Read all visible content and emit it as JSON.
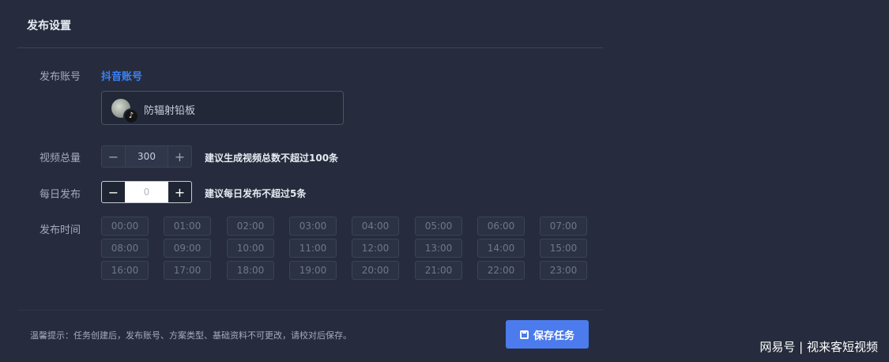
{
  "panel": {
    "title": "发布设置"
  },
  "account": {
    "label": "发布账号",
    "platform_link": "抖音账号",
    "selected_name": "防辐射铅板",
    "badge_icon": "tiktok-icon"
  },
  "total_videos": {
    "label": "视频总量",
    "value": "300",
    "hint": "建议生成视频总数不超过100条",
    "minus": "−",
    "plus": "+"
  },
  "daily_publish": {
    "label": "每日发布",
    "value": "0",
    "hint": "建议每日发布不超过5条",
    "minus": "−",
    "plus": "+"
  },
  "publish_time": {
    "label": "发布时间",
    "slots": [
      "00:00",
      "01:00",
      "02:00",
      "03:00",
      "04:00",
      "05:00",
      "06:00",
      "07:00",
      "08:00",
      "09:00",
      "10:00",
      "11:00",
      "12:00",
      "13:00",
      "14:00",
      "15:00",
      "16:00",
      "17:00",
      "18:00",
      "19:00",
      "20:00",
      "21:00",
      "22:00",
      "23:00"
    ]
  },
  "footer": {
    "note": "温馨提示：任务创建后，发布账号、方案类型、基础资料不可更改，请校对后保存。",
    "save_label": "保存任务"
  },
  "watermark": "网易号 | 视来客短视频"
}
